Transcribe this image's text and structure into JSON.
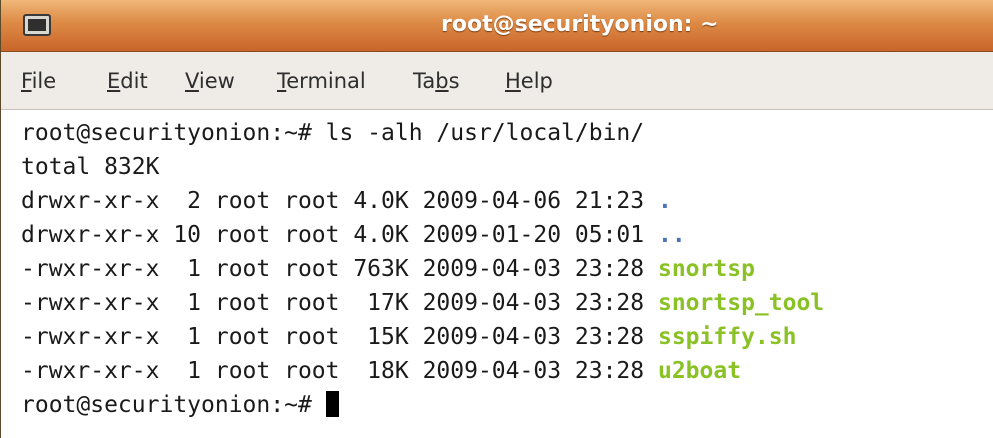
{
  "window": {
    "title": "root@securityonion: ~",
    "title_icon": "terminal-icon"
  },
  "menu": {
    "items": [
      {
        "pre": "",
        "mnemonic": "F",
        "post": "ile"
      },
      {
        "pre": "",
        "mnemonic": "E",
        "post": "dit"
      },
      {
        "pre": "",
        "mnemonic": "V",
        "post": "iew"
      },
      {
        "pre": "",
        "mnemonic": "T",
        "post": "erminal"
      },
      {
        "pre": "Ta",
        "mnemonic": "b",
        "post": "s"
      },
      {
        "pre": "",
        "mnemonic": "H",
        "post": "elp"
      }
    ]
  },
  "terminal": {
    "command_line": "root@securityonion:~# ls -alh /usr/local/bin/",
    "total_line": "total 832K",
    "entries": [
      {
        "info": "drwxr-xr-x  2 root root 4.0K 2009-04-06 21:23 ",
        "name": "."
      },
      {
        "info": "drwxr-xr-x 10 root root 4.0K 2009-01-20 05:01 ",
        "name": ".."
      },
      {
        "info": "-rwxr-xr-x  1 root root 763K 2009-04-03 23:28 ",
        "name": "snortsp"
      },
      {
        "info": "-rwxr-xr-x  1 root root  17K 2009-04-03 23:28 ",
        "name": "snortsp_tool"
      },
      {
        "info": "-rwxr-xr-x  1 root root  15K 2009-04-03 23:28 ",
        "name": "sspiffy.sh"
      },
      {
        "info": "-rwxr-xr-x  1 root root  18K 2009-04-03 23:28 ",
        "name": "u2boat"
      }
    ],
    "prompt": "root@securityonion:~# "
  },
  "colors": {
    "titlebar": "#dd8a45",
    "directory": "#4a73b8",
    "executable": "#8ac226"
  }
}
